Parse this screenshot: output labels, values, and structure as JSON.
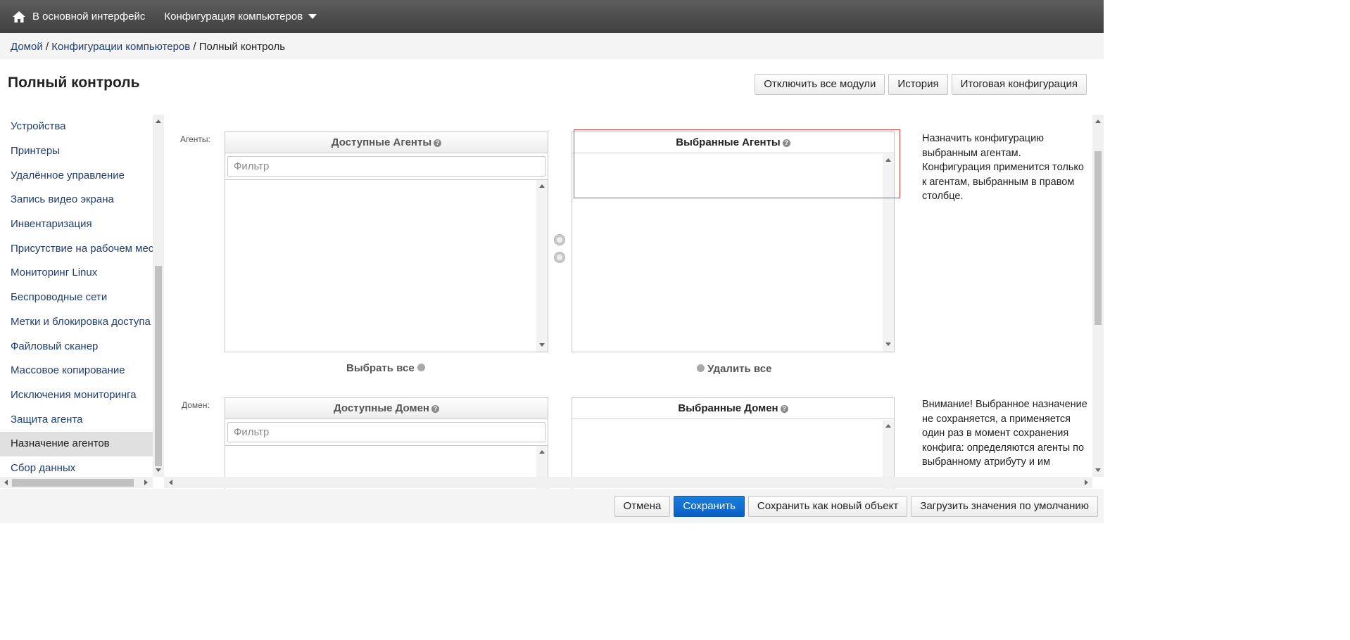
{
  "topbar": {
    "home_label": "В основной интерфейс",
    "menu_label": "Конфигурация компьютеров"
  },
  "breadcrumb": {
    "home": "Домой",
    "sep1": " / ",
    "section": "Конфигурации компьютеров",
    "sep2": " / ",
    "current": "Полный контроль"
  },
  "page": {
    "title": "Полный контроль"
  },
  "top_actions": {
    "disable_all": "Отключить все модули",
    "history": "История",
    "final_config": "Итоговая конфигурация"
  },
  "sidebar": {
    "items": [
      {
        "label": "Устройства"
      },
      {
        "label": "Принтеры"
      },
      {
        "label": "Удалённое управление"
      },
      {
        "label": "Запись видео экрана"
      },
      {
        "label": "Инвентаризация"
      },
      {
        "label": "Присутствие на рабочем месте"
      },
      {
        "label": "Мониторинг Linux"
      },
      {
        "label": "Беспроводные сети"
      },
      {
        "label": "Метки и блокировка доступа"
      },
      {
        "label": "Файловый сканер"
      },
      {
        "label": "Массовое копирование"
      },
      {
        "label": "Исключения мониторинга"
      },
      {
        "label": "Защита агента"
      },
      {
        "label": "Назначение агентов"
      },
      {
        "label": "Сбор данных"
      }
    ],
    "active_index": 13
  },
  "agents": {
    "row_label": "Агенты:",
    "available_title": "Доступные Агенты",
    "selected_title": "Выбранные Агенты",
    "filter_placeholder": "Фильтр",
    "select_all": "Выбрать все",
    "remove_all": "Удалить все",
    "description": "Назначить конфигурацию выбранным агентам. Конфигурация применится только к агентам, выбранным в правом столбце."
  },
  "domain": {
    "row_label": "Домен:",
    "available_title": "Доступные Домен",
    "selected_title": "Выбранные Домен",
    "filter_placeholder": "Фильтр",
    "description": "Внимание! Выбранное назначение не сохраняется, а применяется один раз в момент сохранения конфига: определяются агенты по выбранному атрибуту и им"
  },
  "footer": {
    "cancel": "Отмена",
    "save": "Сохранить",
    "save_as_new": "Сохранить как новый объект",
    "load_defaults": "Загрузить значения по умолчанию"
  },
  "colors": {
    "primary_button": "#0a5fc4",
    "highlight_border": "#e53935",
    "link": "#1f3e6e"
  },
  "icons": {
    "home": "home-icon",
    "caret": "chevron-down-icon",
    "help": "help-icon"
  }
}
